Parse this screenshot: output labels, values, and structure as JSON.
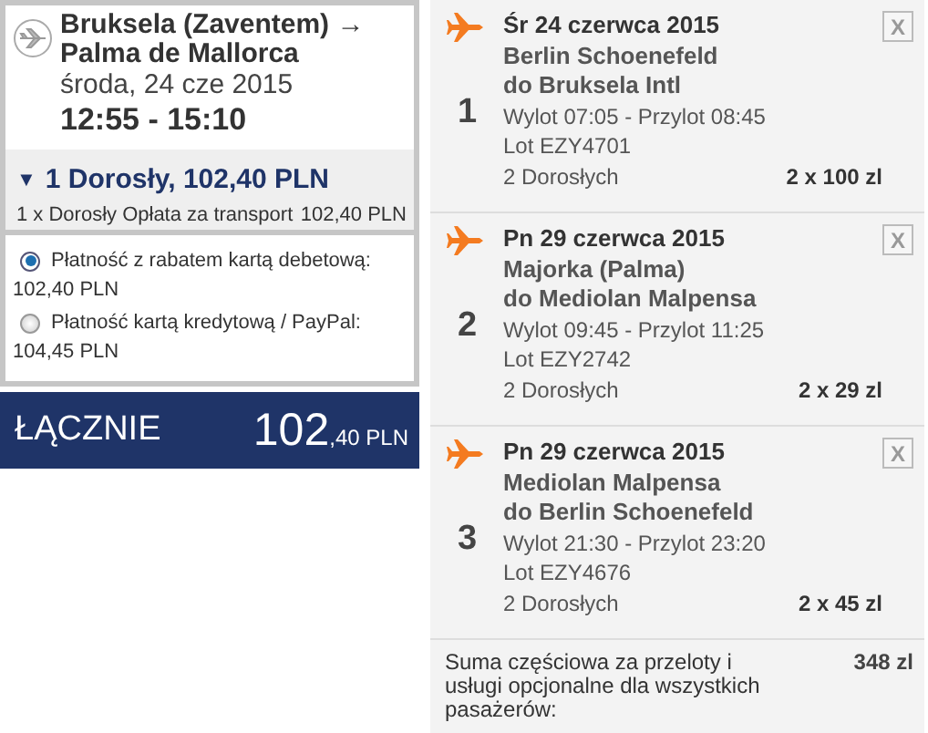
{
  "summary": {
    "route_from": "Bruksela (Zaventem) →",
    "route_to": "Palma de Mallorca",
    "date": "środa, 24 cze 2015",
    "time": "12:55 - 15:10",
    "passengers": {
      "expanded": true,
      "toggle": "▼",
      "label": "1 Dorosły, 102,40 PLN"
    },
    "fare": {
      "label": "1 x Dorosły Opłata za transport",
      "amount": "102,40 PLN"
    },
    "payment_options": [
      {
        "label": "Płatność z rabatem kartą debetową:",
        "amount": "102,40 PLN",
        "selected": true
      },
      {
        "label": "Płatność kartą kredytową / PayPal:",
        "amount": "104,45 PLN",
        "selected": false
      }
    ],
    "total": {
      "label": "ŁĄCZNIE",
      "amount": "102",
      "decimals": ",40",
      "currency": "PLN"
    }
  },
  "flights": [
    {
      "number": "1",
      "date": "Śr 24 czerwca 2015",
      "from": "Berlin Schoenefeld",
      "to": "do Bruksela Intl",
      "times": "Wylot 07:05 - Przylot 08:45",
      "flight": "Lot EZY4701",
      "passengers": "2 Dorosłych",
      "price": "2 x 100 zl",
      "remove": "X"
    },
    {
      "number": "2",
      "date": "Pn 29 czerwca 2015",
      "from": "Majorka (Palma)",
      "to": "do Mediolan Malpensa",
      "times": "Wylot 09:45 - Przylot 11:25",
      "flight": "Lot EZY2742",
      "passengers": "2 Dorosłych",
      "price": "2 x 29 zl",
      "remove": "X"
    },
    {
      "number": "3",
      "date": "Pn 29 czerwca 2015",
      "from": "Mediolan Malpensa",
      "to": "do Berlin Schoenefeld",
      "times": "Wylot 21:30 - Przylot 23:20",
      "flight": "Lot EZY4676",
      "passengers": "2 Dorosłych",
      "price": "2 x 45 zl",
      "remove": "X"
    }
  ],
  "subtotal": {
    "label": "Suma częściowa za przeloty i usługi opcjonalne dla wszystkich pasażerów:",
    "value": "348 zl"
  }
}
